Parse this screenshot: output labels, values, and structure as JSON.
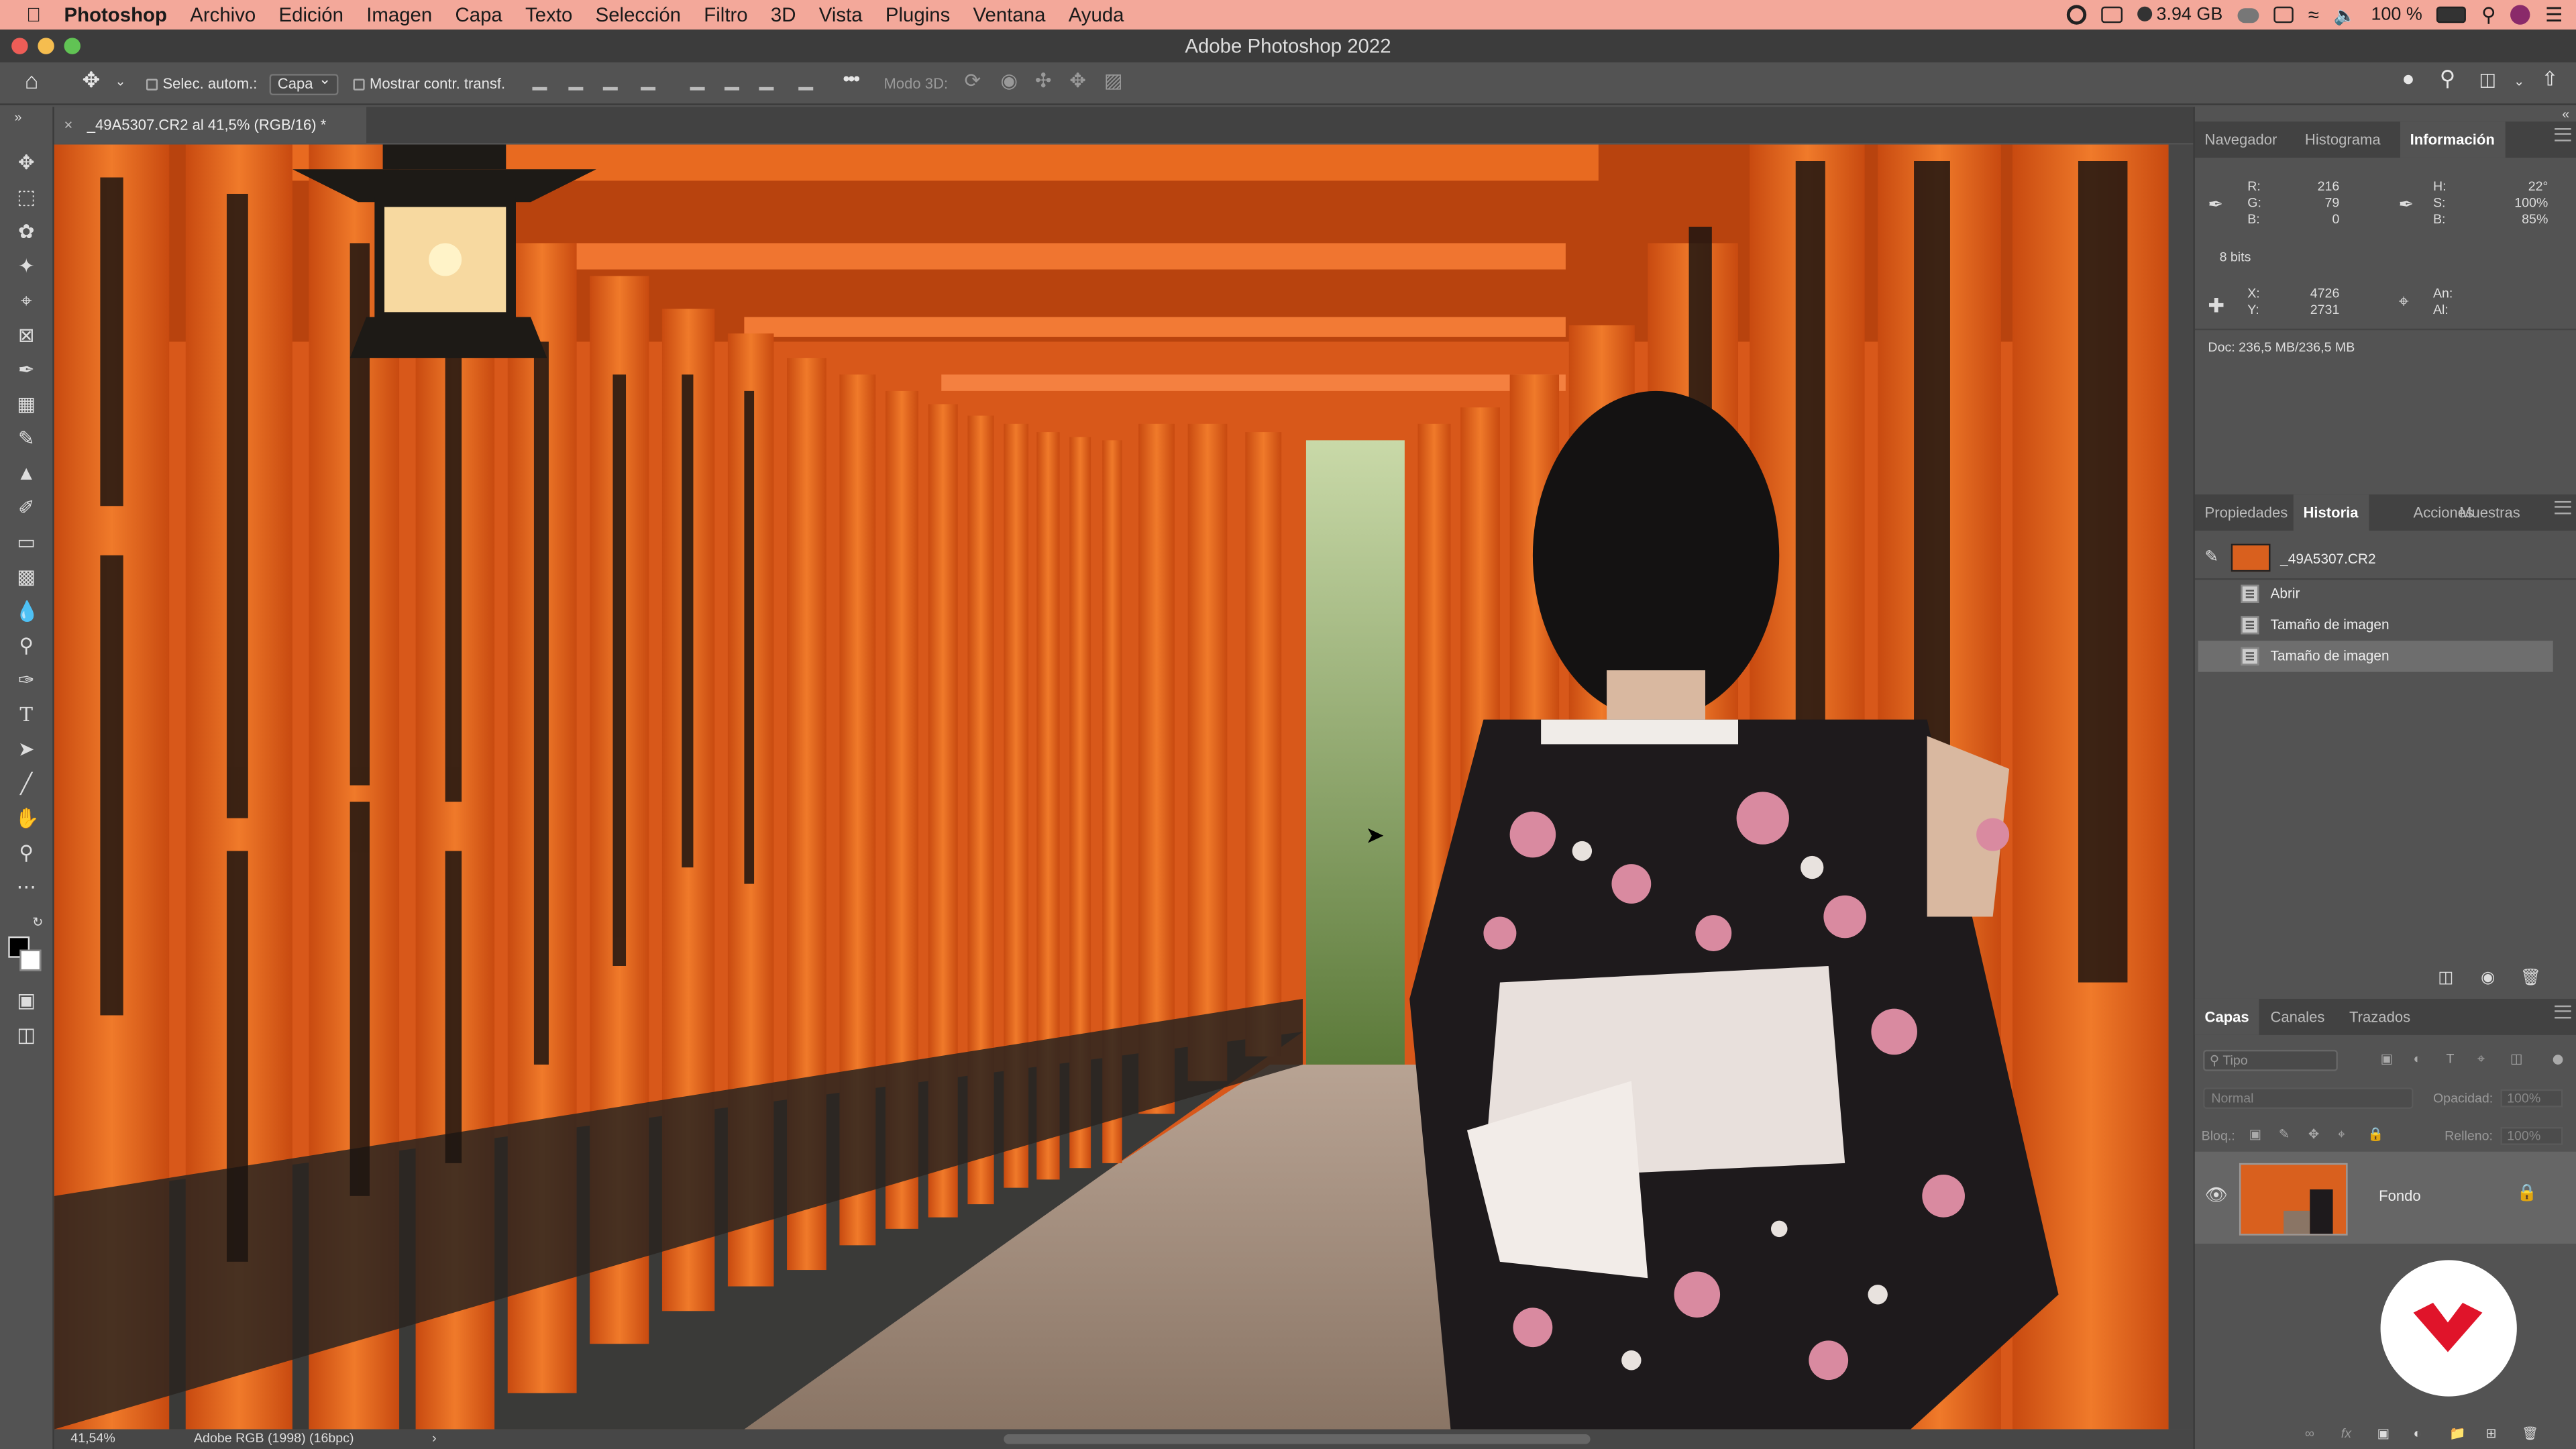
{
  "menubar": {
    "app_name": "Photoshop",
    "items": [
      "Archivo",
      "Edición",
      "Imagen",
      "Capa",
      "Texto",
      "Selección",
      "Filtro",
      "3D",
      "Vista",
      "Plugins",
      "Ventana",
      "Ayuda"
    ],
    "memory": "3.94 GB",
    "battery": "100 %"
  },
  "window": {
    "title": "Adobe Photoshop 2022"
  },
  "options": {
    "auto_select_label": "Selec. autom.:",
    "layer_select": "Capa",
    "show_transform_label": "Mostrar contr. transf.",
    "mode3d_label": "Modo 3D:"
  },
  "document": {
    "tab_title": "_49A5307.CR2 al 41,5% (RGB/16) *"
  },
  "status": {
    "zoom": "41,54%",
    "profile": "Adobe RGB (1998) (16bpc)"
  },
  "info_panel": {
    "tabs": [
      "Navegador",
      "Histograma",
      "Información"
    ],
    "active_tab": "Información",
    "rgb_labels": [
      "R:",
      "G:",
      "B:"
    ],
    "rgb_values": [
      "216",
      "79",
      "0"
    ],
    "hsb_labels": [
      "H:",
      "S:",
      "B:"
    ],
    "hsb_values": [
      "22°",
      "100%",
      "85%"
    ],
    "bits": "8 bits",
    "xy_labels": [
      "X:",
      "Y:"
    ],
    "xy_values": [
      "4726",
      "2731"
    ],
    "wh_labels": [
      "An:",
      "Al:"
    ],
    "doc_size": "Doc: 236,5 MB/236,5 MB"
  },
  "history_panel": {
    "tabs": [
      "Propiedades",
      "Historia",
      "Acciones",
      "Muestras"
    ],
    "active_tab": "Historia",
    "snapshot": "_49A5307.CR2",
    "steps": [
      "Abrir",
      "Tamaño de imagen",
      "Tamaño de imagen"
    ]
  },
  "layers_panel": {
    "tabs": [
      "Capas",
      "Canales",
      "Trazados"
    ],
    "active_tab": "Capas",
    "filter_placeholder": "Tipo",
    "blend_mode": "Normal",
    "opacity_label": "Opacidad:",
    "opacity_value": "100%",
    "lock_label": "Bloq.:",
    "fill_label": "Relleno:",
    "fill_value": "100%",
    "layers": [
      {
        "name": "Fondo"
      }
    ]
  },
  "colors": {
    "menubar_bg": "#f3a89a",
    "torii_orange": "#e8621a",
    "logo_red": "#e0142a"
  }
}
